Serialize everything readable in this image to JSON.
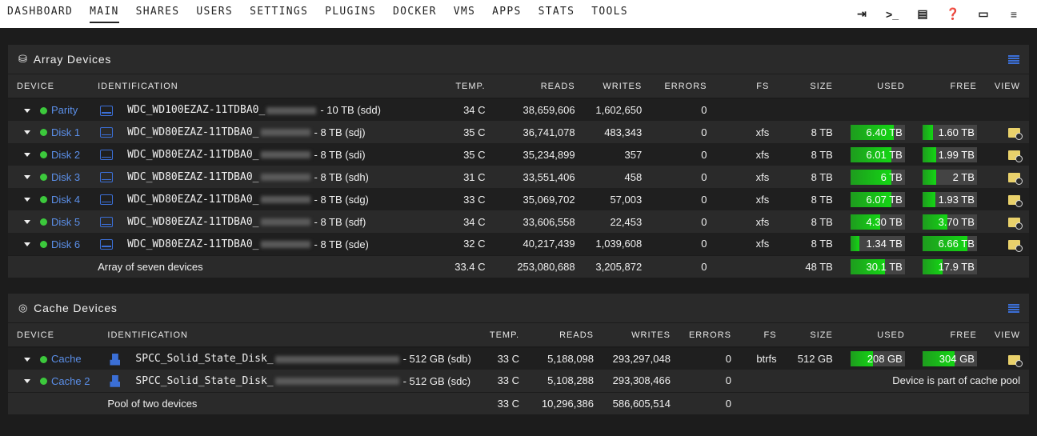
{
  "nav": {
    "items": [
      "DASHBOARD",
      "MAIN",
      "SHARES",
      "USERS",
      "SETTINGS",
      "PLUGINS",
      "DOCKER",
      "VMS",
      "APPS",
      "STATS",
      "TOOLS"
    ],
    "active": "MAIN",
    "icons": [
      "logout-icon",
      "terminal-icon",
      "feedback-icon",
      "help-icon",
      "info-icon",
      "log-icon"
    ]
  },
  "array": {
    "title": "Array Devices",
    "headers": {
      "device": "DEVICE",
      "identification": "IDENTIFICATION",
      "temp": "TEMP.",
      "reads": "READS",
      "writes": "WRITES",
      "errors": "ERRORS",
      "fs": "FS",
      "size": "SIZE",
      "used": "USED",
      "free": "FREE",
      "view": "VIEW"
    },
    "rows": [
      {
        "name": "Parity",
        "ident": "WDC_WD100EZAZ-11TDBA0_",
        "suffix": "- 10 TB (sdd)",
        "temp": "34 C",
        "reads": "38,659,606",
        "writes": "1,602,650",
        "errors": "0",
        "fs": "",
        "size": "",
        "used": "",
        "free": "",
        "used_pct": 0,
        "free_pct": 0
      },
      {
        "name": "Disk 1",
        "ident": "WDC_WD80EZAZ-11TDBA0_",
        "suffix": "- 8 TB (sdj)",
        "temp": "35 C",
        "reads": "36,741,078",
        "writes": "483,343",
        "errors": "0",
        "fs": "xfs",
        "size": "8 TB",
        "used": "6.40 TB",
        "free": "1.60 TB",
        "used_pct": 80,
        "free_pct": 20
      },
      {
        "name": "Disk 2",
        "ident": "WDC_WD80EZAZ-11TDBA0_",
        "suffix": "- 8 TB (sdi)",
        "temp": "35 C",
        "reads": "35,234,899",
        "writes": "357",
        "errors": "0",
        "fs": "xfs",
        "size": "8 TB",
        "used": "6.01 TB",
        "free": "1.99 TB",
        "used_pct": 75,
        "free_pct": 25
      },
      {
        "name": "Disk 3",
        "ident": "WDC_WD80EZAZ-11TDBA0_",
        "suffix": "- 8 TB (sdh)",
        "temp": "31 C",
        "reads": "33,551,406",
        "writes": "458",
        "errors": "0",
        "fs": "xfs",
        "size": "8 TB",
        "used": "6 TB",
        "free": "2 TB",
        "used_pct": 75,
        "free_pct": 25
      },
      {
        "name": "Disk 4",
        "ident": "WDC_WD80EZAZ-11TDBA0_",
        "suffix": "- 8 TB (sdg)",
        "temp": "33 C",
        "reads": "35,069,702",
        "writes": "57,003",
        "errors": "0",
        "fs": "xfs",
        "size": "8 TB",
        "used": "6.07 TB",
        "free": "1.93 TB",
        "used_pct": 76,
        "free_pct": 24
      },
      {
        "name": "Disk 5",
        "ident": "WDC_WD80EZAZ-11TDBA0_",
        "suffix": "- 8 TB (sdf)",
        "temp": "34 C",
        "reads": "33,606,558",
        "writes": "22,453",
        "errors": "0",
        "fs": "xfs",
        "size": "8 TB",
        "used": "4.30 TB",
        "free": "3.70 TB",
        "used_pct": 54,
        "free_pct": 46
      },
      {
        "name": "Disk 6",
        "ident": "WDC_WD80EZAZ-11TDBA0_",
        "suffix": "- 8 TB (sde)",
        "temp": "32 C",
        "reads": "40,217,439",
        "writes": "1,039,608",
        "errors": "0",
        "fs": "xfs",
        "size": "8 TB",
        "used": "1.34 TB",
        "free": "6.66 TB",
        "used_pct": 17,
        "free_pct": 83
      }
    ],
    "summary": {
      "label": "Array of seven devices",
      "temp": "33.4 C",
      "reads": "253,080,688",
      "writes": "3,205,872",
      "errors": "0",
      "size": "48 TB",
      "used": "30.1 TB",
      "free": "17.9 TB",
      "used_pct": 63,
      "free_pct": 37
    }
  },
  "cache": {
    "title": "Cache Devices",
    "headers": {
      "device": "DEVICE",
      "identification": "IDENTIFICATION",
      "temp": "TEMP.",
      "reads": "READS",
      "writes": "WRITES",
      "errors": "ERRORS",
      "fs": "FS",
      "size": "SIZE",
      "used": "USED",
      "free": "FREE",
      "view": "VIEW"
    },
    "rows": [
      {
        "name": "Cache",
        "ident": "SPCC_Solid_State_Disk_",
        "suffix": "- 512 GB (sdb)",
        "temp": "33 C",
        "reads": "5,188,098",
        "writes": "293,297,048",
        "errors": "0",
        "fs": "btrfs",
        "size": "512 GB",
        "used": "208 GB",
        "free": "304 GB",
        "used_pct": 41,
        "free_pct": 59
      },
      {
        "name": "Cache 2",
        "ident": "SPCC_Solid_State_Disk_",
        "suffix": "- 512 GB (sdc)",
        "temp": "33 C",
        "reads": "5,108,288",
        "writes": "293,308,466",
        "errors": "0",
        "note": "Device is part of cache pool"
      }
    ],
    "summary": {
      "label": "Pool of two devices",
      "temp": "33 C",
      "reads": "10,296,386",
      "writes": "586,605,514",
      "errors": "0"
    }
  }
}
